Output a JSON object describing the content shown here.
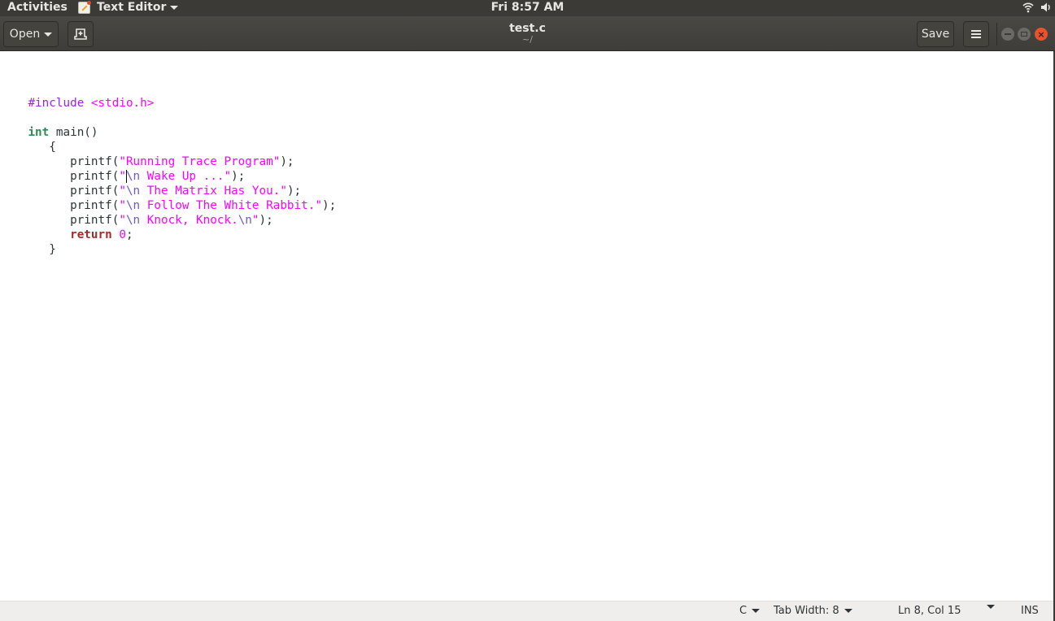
{
  "system_bar": {
    "activities": "Activities",
    "app_name": "Text Editor",
    "clock": "Fri  8:57 AM",
    "tray_icons": [
      "wifi-icon",
      "volume-icon"
    ]
  },
  "header": {
    "open_label": "Open",
    "title": "test.c",
    "subtitle": "~/",
    "save_label": "Save",
    "new_document_icon": "new-document-icon",
    "menu_icon": "hamburger-menu-icon",
    "window_controls": [
      "minimize",
      "maximize",
      "close"
    ]
  },
  "editor": {
    "lines": {
      "l1_pre": "#include ",
      "l1_hdr": "<stdio.h>",
      "l3_type": "int",
      "l3_rest": " main()",
      "l4": "   {",
      "l5_pre": "      printf(",
      "l5_str": "\"Running Trace Program\"",
      "l5_post": ");",
      "l6_pre": "      printf(",
      "l6_q": "\"",
      "l6_esc": "\\n",
      "l6_str": " Wake Up ...\"",
      "l6_post": ");",
      "l7_pre": "      printf(",
      "l7_q": "\"",
      "l7_esc": "\\n",
      "l7_str": " The Matrix Has You.\"",
      "l7_post": ");",
      "l8_pre": "      printf(",
      "l8_q": "\"",
      "l8_esc": "\\n",
      "l8_str": " Follow The White Rabbit.\"",
      "l8_post": ");",
      "l9_pre": "      printf(",
      "l9_q": "\"",
      "l9_esc": "\\n",
      "l9_str": " Knock, Knock.",
      "l9_esc2": "\\n",
      "l9_q2": "\"",
      "l9_post": ");",
      "l10_indent": "      ",
      "l10_kw": "return",
      "l10_sp": " ",
      "l10_num": "0",
      "l10_post": ";",
      "l11": "   }"
    }
  },
  "status_bar": {
    "language": "C",
    "tab_width": "Tab Width: 8",
    "cursor_position": "Ln 8, Col 15",
    "insert_mode": "INS"
  }
}
